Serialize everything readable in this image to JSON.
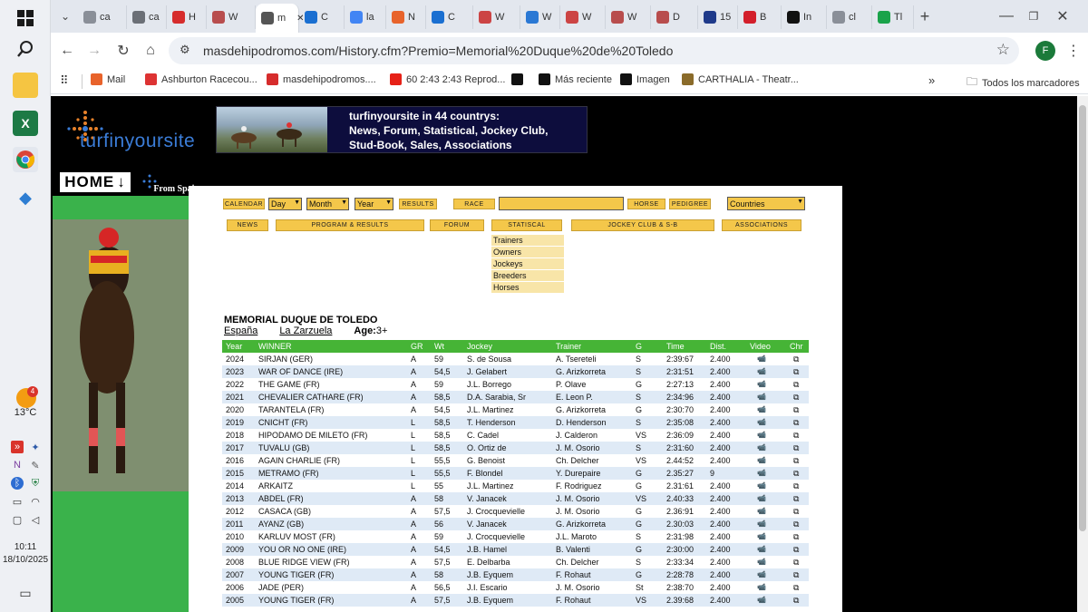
{
  "taskbar": {
    "weather_temp": "13°C",
    "weather_badge": "4",
    "time": "10:11",
    "date": "18/10/2025"
  },
  "browser": {
    "tabs": [
      {
        "label": "ca",
        "icon": "globe-icon"
      },
      {
        "label": "ca",
        "icon": "mail-icon"
      },
      {
        "label": "H",
        "icon": "bars-icon"
      },
      {
        "label": "W",
        "icon": "swirl-icon"
      },
      {
        "label": "m",
        "icon": "page-icon"
      },
      {
        "label": "C",
        "icon": "outlook-icon"
      },
      {
        "label": "la",
        "icon": "google-icon"
      },
      {
        "label": "N",
        "icon": "logo-icon"
      },
      {
        "label": "C",
        "icon": "outlook-icon"
      },
      {
        "label": "W",
        "icon": "site-icon"
      },
      {
        "label": "W",
        "icon": "a-icon"
      },
      {
        "label": "W",
        "icon": "site-icon"
      },
      {
        "label": "W",
        "icon": "swirl-icon"
      },
      {
        "label": "D",
        "icon": "swirl-icon"
      },
      {
        "label": "15",
        "icon": "ak-icon"
      },
      {
        "label": "B",
        "icon": "b-icon"
      },
      {
        "label": "In",
        "icon": "x-icon"
      },
      {
        "label": "cl",
        "icon": "globe-icon"
      },
      {
        "label": "Tl",
        "icon": "green-icon"
      }
    ],
    "url": "masdehipodromos.com/History.cfm?Premio=Memorial%20Duque%20de%20Toledo",
    "profile_initial": "F",
    "bookmarks": [
      {
        "label": "Mail",
        "icon": "logo-icon"
      },
      {
        "label": "Ashburton Racecou...",
        "icon": "pin-icon"
      },
      {
        "label": "masdehipodromos....",
        "icon": "bars-icon"
      },
      {
        "label": "60 2:43 2:43 Reprod...",
        "icon": "youtube-icon"
      },
      {
        "label": "",
        "icon": "x-icon"
      },
      {
        "label": "Más reciente",
        "icon": "x-icon"
      },
      {
        "label": "Imagen",
        "icon": "x-icon"
      },
      {
        "label": "CARTHALIA - Theatr...",
        "icon": "theatre-icon"
      }
    ],
    "all_bookmarks": "Todos los marcadores"
  },
  "site": {
    "logo_text": "turfinyoursite",
    "banner_lines": [
      "turfinyoursite in 44 countrys:",
      "News, Forum, Statistical, Jockey Club,",
      "Stud-Book, Sales, Associations"
    ],
    "home_label": "HOME",
    "from_spain": "From Spain",
    "search_bar": {
      "calendar": "CALENDAR",
      "day": "Day",
      "month": "Month",
      "year": "Year",
      "results": "RESULTS",
      "race": "RACE",
      "horse": "HORSE",
      "pedigree": "PEDIGREE",
      "countries": "Countries"
    },
    "nav": {
      "news": "NEWS",
      "program": "PROGRAM & RESULTS",
      "forum": "FORUM",
      "statistical": "STATISCAL",
      "jockey_club": "JOCKEY CLUB & S-B",
      "associations": "ASSOCIATIONS"
    },
    "stat_menu": [
      "Trainers",
      "Owners",
      "Jockeys",
      "Breeders",
      "Horses"
    ]
  },
  "race": {
    "title": "MEMORIAL DUQUE DE TOLEDO",
    "country": "España",
    "course": "La Zarzuela",
    "age_label": "Age:",
    "age_value": "3+"
  },
  "table": {
    "headers": [
      "Year",
      "WINNER",
      "GR",
      "Wt",
      "Jockey",
      "Trainer",
      "G",
      "Time",
      "Dist.",
      "Video",
      "Chr"
    ],
    "rows": [
      [
        "2024",
        "SIRJAN (GER)",
        "A",
        "59",
        "S. de Sousa",
        "A. Tsereteli",
        "S",
        "2:39:67",
        "2.400"
      ],
      [
        "2023",
        "WAR OF DANCE (IRE)",
        "A",
        "54,5",
        "J. Gelabert",
        "G. Arizkorreta",
        "S",
        "2:31:51",
        "2.400"
      ],
      [
        "2022",
        "THE GAME (FR)",
        "A",
        "59",
        "J.L. Borrego",
        "P. Olave",
        "G",
        "2:27:13",
        "2.400"
      ],
      [
        "2021",
        "CHEVALIER CATHARE (FR)",
        "A",
        "58,5",
        "D.A. Sarabia, Sr",
        "E. Leon P.",
        "S",
        "2:34:96",
        "2.400"
      ],
      [
        "2020",
        "TARANTELA (FR)",
        "A",
        "54,5",
        "J.L. Martinez",
        "G. Arizkorreta",
        "G",
        "2:30:70",
        "2.400"
      ],
      [
        "2019",
        "CNICHT (FR)",
        "L",
        "58,5",
        "T. Henderson",
        "D. Henderson",
        "S",
        "2:35:08",
        "2.400"
      ],
      [
        "2018",
        "HIPODAMO DE MILETO (FR)",
        "L",
        "58,5",
        "C. Cadel",
        "J. Calderon",
        "VS",
        "2:36:09",
        "2.400"
      ],
      [
        "2017",
        "TUVALU (GB)",
        "L",
        "58,5",
        "O. Ortiz de",
        "J. M. Osorio",
        "S",
        "2:31:60",
        "2.400"
      ],
      [
        "2016",
        "AGAIN CHARLIE (FR)",
        "L",
        "55,5",
        "G. Benoist",
        "Ch. Delcher",
        "VS",
        "2.44:52",
        "2.400"
      ],
      [
        "2015",
        "METRAMO (FR)",
        "L",
        "55,5",
        "F. Blondel",
        "Y. Durepaire",
        "G",
        "2.35:27",
        "9"
      ],
      [
        "2014",
        "ARKAITZ",
        "L",
        "55",
        "J.L. Martinez",
        "F. Rodriguez",
        "G",
        "2.31:61",
        "2.400"
      ],
      [
        "2013",
        "ABDEL (FR)",
        "A",
        "58",
        "V. Janacek",
        "J. M. Osorio",
        "VS",
        "2.40:33",
        "2.400"
      ],
      [
        "2012",
        "CASACA (GB)",
        "A",
        "57,5",
        "J. Crocquevielle",
        "J. M. Osorio",
        "G",
        "2.36:91",
        "2.400"
      ],
      [
        "2011",
        "AYANZ (GB)",
        "A",
        "56",
        "V. Janacek",
        "G. Arizkorreta",
        "G",
        "2.30:03",
        "2.400"
      ],
      [
        "2010",
        "KARLUV MOST (FR)",
        "A",
        "59",
        "J. Crocquevielle",
        "J.L. Maroto",
        "S",
        "2:31:98",
        "2.400"
      ],
      [
        "2009",
        "YOU OR NO ONE (IRE)",
        "A",
        "54,5",
        "J.B. Hamel",
        "B. Valenti",
        "G",
        "2:30:00",
        "2.400"
      ],
      [
        "2008",
        "BLUE RIDGE VIEW (FR)",
        "A",
        "57,5",
        "E. Delbarba",
        "Ch. Delcher",
        "S",
        "2:33:34",
        "2.400"
      ],
      [
        "2007",
        "YOUNG TIGER (FR)",
        "A",
        "58",
        "J.B. Eyquem",
        "F. Rohaut",
        "G",
        "2:28:78",
        "2.400"
      ],
      [
        "2006",
        "JADE (PER)",
        "A",
        "56,5",
        "J.I. Escario",
        "J. M. Osorio",
        "St",
        "2:38:70",
        "2.400"
      ],
      [
        "2005",
        "YOUNG TIGER (FR)",
        "A",
        "57,5",
        "J.B. Eyquem",
        "F. Rohaut",
        "VS",
        "2.39:68",
        "2.400"
      ]
    ],
    "video_icon": "📹",
    "chr_icon": "⧉"
  }
}
